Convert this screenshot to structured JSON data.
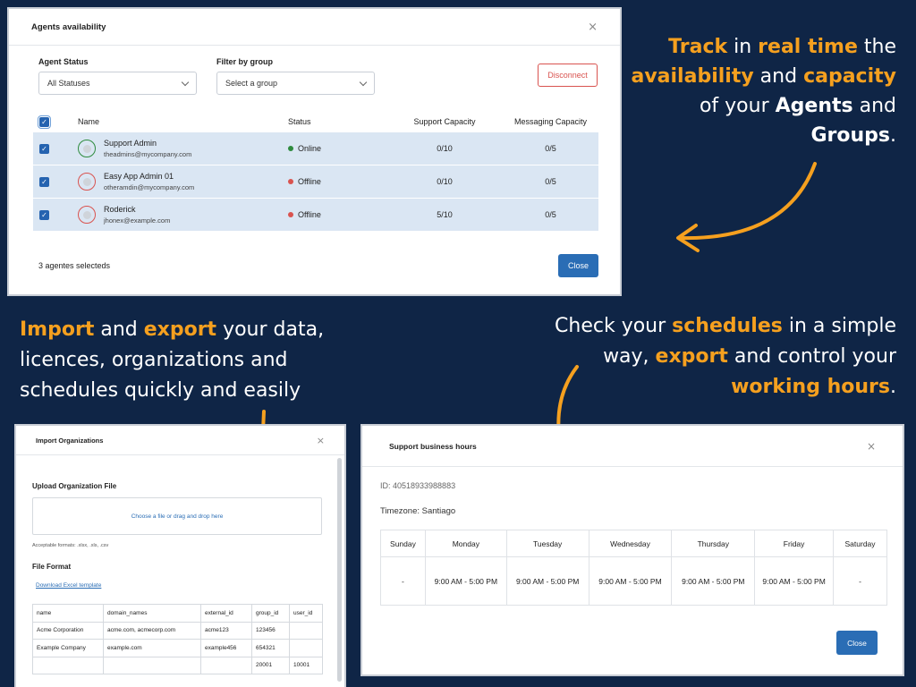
{
  "agents_panel": {
    "title": "Agents availability",
    "close_x": "×",
    "status_label": "Agent Status",
    "status_value": "All Statuses",
    "group_label": "Filter by group",
    "group_placeholder": "Select a group",
    "disconnect_label": "Disconnect",
    "columns": [
      "Name",
      "Status",
      "Support Capacity",
      "Messaging Capacity"
    ],
    "agents": [
      {
        "name": "Support Admin",
        "email": "theadmins@mycompany.com",
        "status": "Online",
        "support": "0/10",
        "messaging": "0/5"
      },
      {
        "name": "Easy App Admin 01",
        "email": "otheramdin@mycompany.com",
        "status": "Offline",
        "support": "0/10",
        "messaging": "0/5"
      },
      {
        "name": "Roderick",
        "email": "jhonex@example.com",
        "status": "Offline",
        "support": "5/10",
        "messaging": "0/5"
      }
    ],
    "footer": "3 agentes selecteds",
    "close_label": "Close"
  },
  "marketing": {
    "t1": [
      [
        "Track",
        true
      ],
      [
        " in ",
        false
      ],
      [
        "real time",
        true
      ],
      [
        " the ",
        false
      ],
      [
        "availability",
        true
      ],
      [
        " and ",
        false
      ],
      [
        "capacity",
        true
      ],
      [
        " of your ",
        false
      ],
      [
        "Agents",
        "b"
      ],
      [
        " and ",
        false
      ],
      [
        "Groups",
        "b"
      ],
      [
        ".",
        false
      ]
    ],
    "t2": [
      [
        "Import",
        true
      ],
      [
        " and ",
        false
      ],
      [
        "export",
        true
      ],
      [
        " your data, licences, organizations and schedules quickly and easily",
        false
      ]
    ],
    "t3": [
      [
        "Check your ",
        false
      ],
      [
        "schedules",
        true
      ],
      [
        " in a simple way, ",
        false
      ],
      [
        "export",
        true
      ],
      [
        " and control your ",
        false
      ],
      [
        "working hours",
        true
      ],
      [
        ".",
        false
      ]
    ]
  },
  "import_panel": {
    "title": "Import Organizations",
    "close_x": "×",
    "upload_heading": "Upload Organization File",
    "dropzone_text": "Choose a file or drag and drop here",
    "formats_note": "Acceptable formats: .xlsx, .xls, .csv",
    "format_heading": "File Format",
    "template_link": "Download Excel template",
    "rows": [
      [
        "name",
        "domain_names",
        "external_id",
        "group_id",
        "user_id"
      ],
      [
        "Acme Corporation",
        "acme.com, acmecorp.com",
        "acme123",
        "123456",
        ""
      ],
      [
        "Example Company",
        "example.com",
        "example456",
        "654321",
        ""
      ],
      [
        "",
        "",
        "",
        "20001",
        "10001"
      ]
    ]
  },
  "hours_panel": {
    "title": "Support business hours",
    "close_x": "×",
    "id_text": "ID: 40518933988883",
    "timezone": "Timezone: Santiago",
    "days": [
      "Sunday",
      "Monday",
      "Tuesday",
      "Wednesday",
      "Thursday",
      "Friday",
      "Saturday"
    ],
    "hours": [
      "-",
      "9:00 AM - 5:00 PM",
      "9:00 AM - 5:00 PM",
      "9:00 AM - 5:00 PM",
      "9:00 AM - 5:00 PM",
      "9:00 AM - 5:00 PM",
      "-"
    ],
    "close_label": "Close"
  },
  "colors": {
    "background": "#0f2546",
    "highlight": "#f5a01f",
    "primary": "#2a6db5",
    "online": "#2e8b3e",
    "offline": "#d9534f",
    "selected_row": "#dae6f3"
  }
}
